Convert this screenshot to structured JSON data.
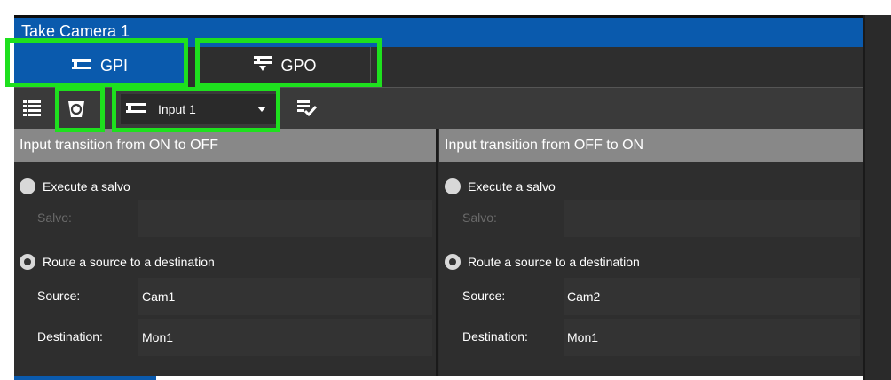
{
  "window": {
    "title": "Take Camera 1"
  },
  "tabs": [
    {
      "label": "GPI",
      "icon": "gpi-icon",
      "active": true
    },
    {
      "label": "GPO",
      "icon": "gpo-icon",
      "active": false
    }
  ],
  "toolbar": {
    "list_icon": "list-icon",
    "refresh_icon": "refresh-icon",
    "input_select": {
      "icon": "gpi-icon",
      "value": "Input 1"
    },
    "apply_icon": "checklist-icon"
  },
  "panels": {
    "left": {
      "heading": "Input transition from ON to OFF",
      "salvo_option": "Execute a salvo",
      "salvo_label": "Salvo:",
      "salvo_value": "",
      "route_option": "Route a source to a destination",
      "source_label": "Source:",
      "source_value": "Cam1",
      "destination_label": "Destination:",
      "destination_value": "Mon1"
    },
    "right": {
      "heading": "Input transition from OFF to ON",
      "salvo_option": "Execute a salvo",
      "salvo_label": "Salvo:",
      "salvo_value": "",
      "route_option": "Route a source to a destination",
      "source_label": "Source:",
      "source_value": "Cam2",
      "destination_label": "Destination:",
      "destination_value": "Mon1"
    }
  },
  "colors": {
    "accent_blue": "#0a5aad",
    "highlight_green": "#1ee01e",
    "panel_header_gray": "#888888"
  }
}
